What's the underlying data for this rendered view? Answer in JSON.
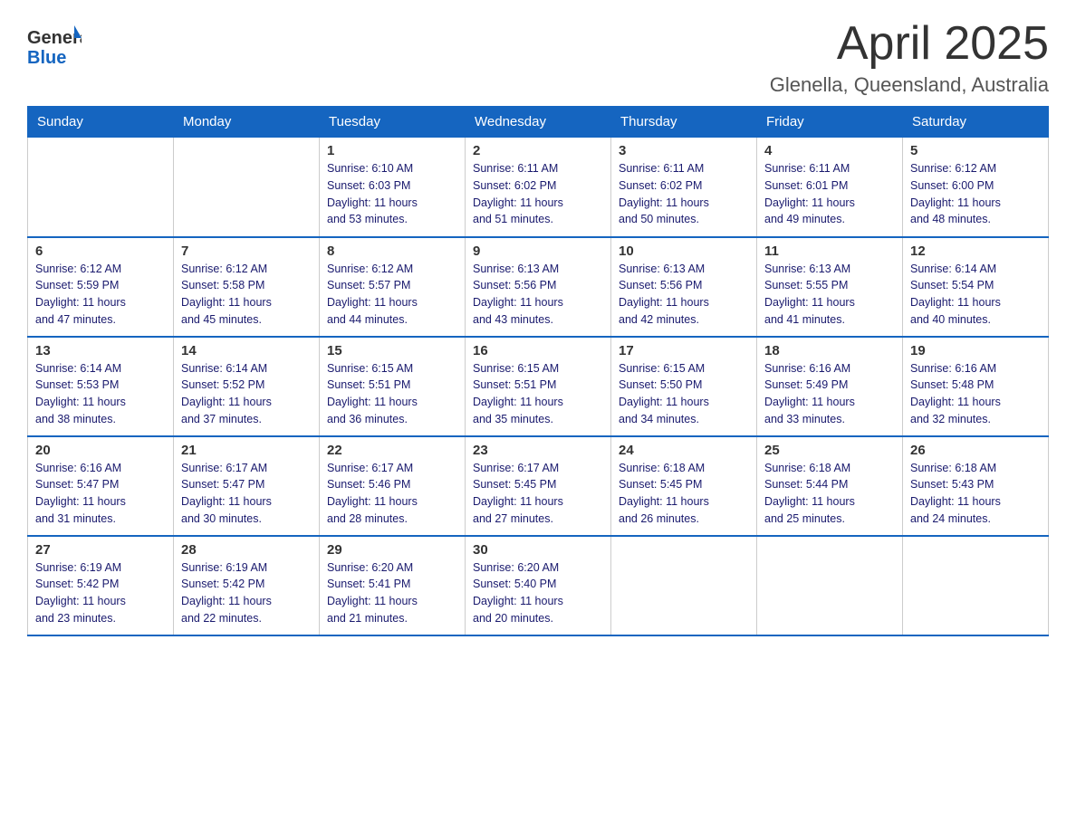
{
  "header": {
    "logo_general": "General",
    "logo_blue": "Blue",
    "title": "April 2025",
    "subtitle": "Glenella, Queensland, Australia"
  },
  "weekdays": [
    "Sunday",
    "Monday",
    "Tuesday",
    "Wednesday",
    "Thursday",
    "Friday",
    "Saturday"
  ],
  "weeks": [
    [
      {
        "day": "",
        "info": ""
      },
      {
        "day": "",
        "info": ""
      },
      {
        "day": "1",
        "info": "Sunrise: 6:10 AM\nSunset: 6:03 PM\nDaylight: 11 hours\nand 53 minutes."
      },
      {
        "day": "2",
        "info": "Sunrise: 6:11 AM\nSunset: 6:02 PM\nDaylight: 11 hours\nand 51 minutes."
      },
      {
        "day": "3",
        "info": "Sunrise: 6:11 AM\nSunset: 6:02 PM\nDaylight: 11 hours\nand 50 minutes."
      },
      {
        "day": "4",
        "info": "Sunrise: 6:11 AM\nSunset: 6:01 PM\nDaylight: 11 hours\nand 49 minutes."
      },
      {
        "day": "5",
        "info": "Sunrise: 6:12 AM\nSunset: 6:00 PM\nDaylight: 11 hours\nand 48 minutes."
      }
    ],
    [
      {
        "day": "6",
        "info": "Sunrise: 6:12 AM\nSunset: 5:59 PM\nDaylight: 11 hours\nand 47 minutes."
      },
      {
        "day": "7",
        "info": "Sunrise: 6:12 AM\nSunset: 5:58 PM\nDaylight: 11 hours\nand 45 minutes."
      },
      {
        "day": "8",
        "info": "Sunrise: 6:12 AM\nSunset: 5:57 PM\nDaylight: 11 hours\nand 44 minutes."
      },
      {
        "day": "9",
        "info": "Sunrise: 6:13 AM\nSunset: 5:56 PM\nDaylight: 11 hours\nand 43 minutes."
      },
      {
        "day": "10",
        "info": "Sunrise: 6:13 AM\nSunset: 5:56 PM\nDaylight: 11 hours\nand 42 minutes."
      },
      {
        "day": "11",
        "info": "Sunrise: 6:13 AM\nSunset: 5:55 PM\nDaylight: 11 hours\nand 41 minutes."
      },
      {
        "day": "12",
        "info": "Sunrise: 6:14 AM\nSunset: 5:54 PM\nDaylight: 11 hours\nand 40 minutes."
      }
    ],
    [
      {
        "day": "13",
        "info": "Sunrise: 6:14 AM\nSunset: 5:53 PM\nDaylight: 11 hours\nand 38 minutes."
      },
      {
        "day": "14",
        "info": "Sunrise: 6:14 AM\nSunset: 5:52 PM\nDaylight: 11 hours\nand 37 minutes."
      },
      {
        "day": "15",
        "info": "Sunrise: 6:15 AM\nSunset: 5:51 PM\nDaylight: 11 hours\nand 36 minutes."
      },
      {
        "day": "16",
        "info": "Sunrise: 6:15 AM\nSunset: 5:51 PM\nDaylight: 11 hours\nand 35 minutes."
      },
      {
        "day": "17",
        "info": "Sunrise: 6:15 AM\nSunset: 5:50 PM\nDaylight: 11 hours\nand 34 minutes."
      },
      {
        "day": "18",
        "info": "Sunrise: 6:16 AM\nSunset: 5:49 PM\nDaylight: 11 hours\nand 33 minutes."
      },
      {
        "day": "19",
        "info": "Sunrise: 6:16 AM\nSunset: 5:48 PM\nDaylight: 11 hours\nand 32 minutes."
      }
    ],
    [
      {
        "day": "20",
        "info": "Sunrise: 6:16 AM\nSunset: 5:47 PM\nDaylight: 11 hours\nand 31 minutes."
      },
      {
        "day": "21",
        "info": "Sunrise: 6:17 AM\nSunset: 5:47 PM\nDaylight: 11 hours\nand 30 minutes."
      },
      {
        "day": "22",
        "info": "Sunrise: 6:17 AM\nSunset: 5:46 PM\nDaylight: 11 hours\nand 28 minutes."
      },
      {
        "day": "23",
        "info": "Sunrise: 6:17 AM\nSunset: 5:45 PM\nDaylight: 11 hours\nand 27 minutes."
      },
      {
        "day": "24",
        "info": "Sunrise: 6:18 AM\nSunset: 5:45 PM\nDaylight: 11 hours\nand 26 minutes."
      },
      {
        "day": "25",
        "info": "Sunrise: 6:18 AM\nSunset: 5:44 PM\nDaylight: 11 hours\nand 25 minutes."
      },
      {
        "day": "26",
        "info": "Sunrise: 6:18 AM\nSunset: 5:43 PM\nDaylight: 11 hours\nand 24 minutes."
      }
    ],
    [
      {
        "day": "27",
        "info": "Sunrise: 6:19 AM\nSunset: 5:42 PM\nDaylight: 11 hours\nand 23 minutes."
      },
      {
        "day": "28",
        "info": "Sunrise: 6:19 AM\nSunset: 5:42 PM\nDaylight: 11 hours\nand 22 minutes."
      },
      {
        "day": "29",
        "info": "Sunrise: 6:20 AM\nSunset: 5:41 PM\nDaylight: 11 hours\nand 21 minutes."
      },
      {
        "day": "30",
        "info": "Sunrise: 6:20 AM\nSunset: 5:40 PM\nDaylight: 11 hours\nand 20 minutes."
      },
      {
        "day": "",
        "info": ""
      },
      {
        "day": "",
        "info": ""
      },
      {
        "day": "",
        "info": ""
      }
    ]
  ]
}
